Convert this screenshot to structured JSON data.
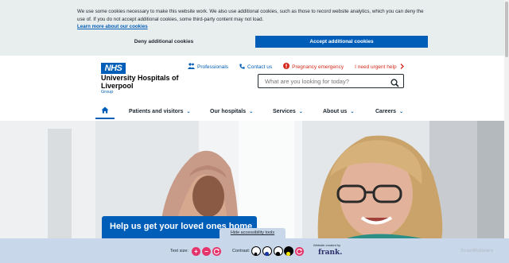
{
  "cookie_banner": {
    "text": "We use some cookies necessary to make this website work. We also use additional cookies, such as those to record website analytics, which you can deny the use of. If you do not accept additional cookies, some third-party content may not load.",
    "learn_more": "Learn more about our cookies",
    "deny_label": "Deny additional cookies",
    "accept_label": "Accept additional cookies"
  },
  "header": {
    "logo_text": "NHS",
    "org_name": "University Hospitals of Liverpool",
    "org_sub": "Group",
    "top_links": [
      {
        "label": "Professionals",
        "icon": "people-icon"
      },
      {
        "label": "Contact us",
        "icon": "phone-icon"
      },
      {
        "label": "Pregnancy emergency",
        "icon": "alert-icon"
      },
      {
        "label": "I need urgent help",
        "icon": "chevron-right-icon"
      }
    ],
    "search_placeholder": "What are you looking for today?"
  },
  "nav": {
    "items": [
      {
        "label": "Patients and visitors"
      },
      {
        "label": "Our hospitals"
      },
      {
        "label": "Services"
      },
      {
        "label": "About us"
      },
      {
        "label": "Careers"
      }
    ]
  },
  "hero": {
    "cta_text": "Help us get your loved ones home"
  },
  "accessibility": {
    "hide_tools": "Hide accessibility tools",
    "text_size_label": "Text size:",
    "contrast_label": "Contrast:",
    "site_created_by": "Website created by",
    "frank": "frank.",
    "scanmalware": "ScanMalware"
  },
  "colors": {
    "nhs_blue": "#005eb8",
    "emergency_red": "#d5281b",
    "a11y_pink": "#e5336b"
  }
}
